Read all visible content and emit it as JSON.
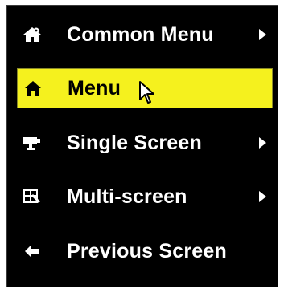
{
  "menu": {
    "items": [
      {
        "label": "Common Menu",
        "icon": "home-settings-icon",
        "has_submenu": true,
        "selected": false
      },
      {
        "label": "Menu",
        "icon": "home-icon",
        "has_submenu": false,
        "selected": true
      },
      {
        "label": "Single Screen",
        "icon": "camera-icon",
        "has_submenu": true,
        "selected": false
      },
      {
        "label": "Multi-screen",
        "icon": "multiscreen-icon",
        "has_submenu": true,
        "selected": false
      },
      {
        "label": "Previous Screen",
        "icon": "back-arrow-icon",
        "has_submenu": false,
        "selected": false
      }
    ]
  },
  "colors": {
    "background": "#000000",
    "text": "#ffffff",
    "highlight": "#f5f11e",
    "highlight_text": "#000000"
  }
}
